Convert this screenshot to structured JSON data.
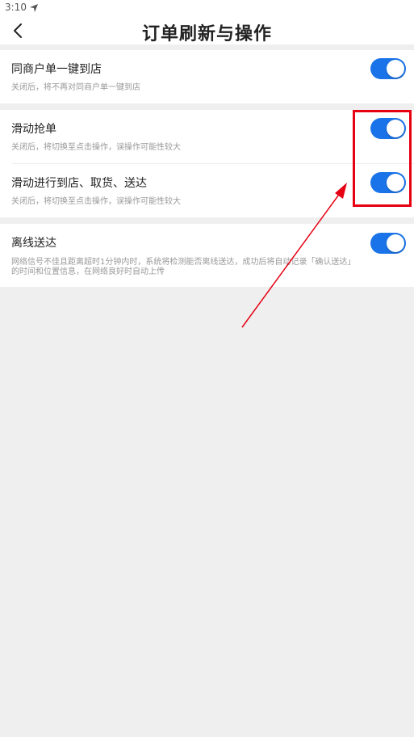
{
  "status_bar": {
    "time": "3:10",
    "nav_icon": "location-arrow-icon"
  },
  "header": {
    "title": "订单刷新与操作",
    "back_icon": "chevron-left-icon"
  },
  "settings": [
    {
      "title": "同商户单一键到店",
      "description": "关闭后，将不再对同商户单一键到店",
      "enabled": true
    },
    {
      "title": "滑动抢单",
      "description": "关闭后，将切换至点击操作，误操作可能性较大",
      "enabled": true
    },
    {
      "title": "滑动进行到店、取货、送达",
      "description": "关闭后，将切换至点击操作，误操作可能性较大",
      "enabled": true
    },
    {
      "title": "离线送达",
      "description_line1": "网络信号不佳且距离超时1分钟内时，系统将检测能否离线送达，成功后将自动记录「确认送达」",
      "description_line2": "的时间和位置信息，在网络良好时自动上传",
      "enabled": true
    }
  ],
  "colors": {
    "toggle_on": "#1a73e8",
    "annotation": "#e60012",
    "background": "#efefef"
  }
}
